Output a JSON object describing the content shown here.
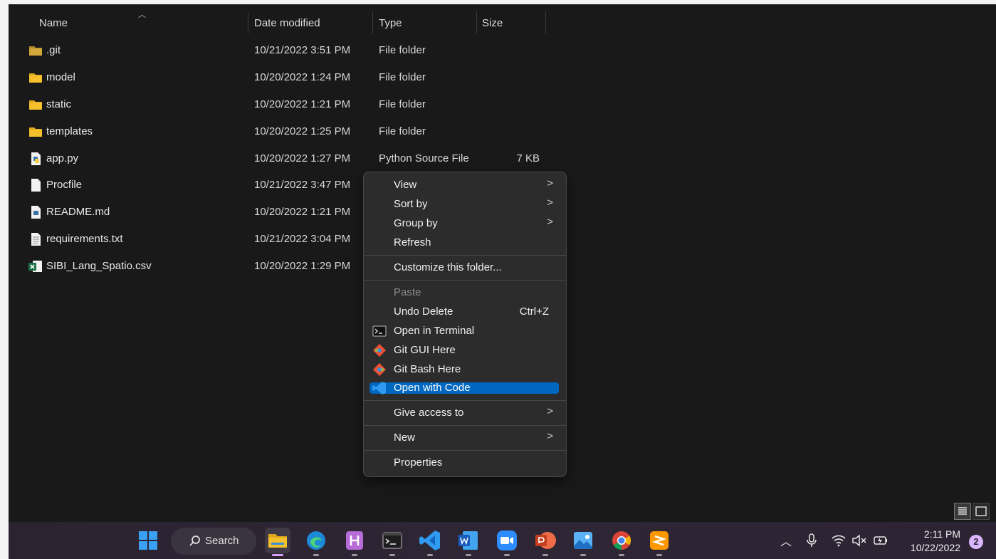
{
  "headers": {
    "name": "Name",
    "date": "Date modified",
    "type": "Type",
    "size": "Size"
  },
  "files": [
    {
      "name": ".git",
      "date": "10/21/2022 3:51 PM",
      "type": "File folder",
      "size": "",
      "icon": "folder-icon"
    },
    {
      "name": "model",
      "date": "10/20/2022 1:24 PM",
      "type": "File folder",
      "size": "",
      "icon": "folder-icon"
    },
    {
      "name": "static",
      "date": "10/20/2022 1:21 PM",
      "type": "File folder",
      "size": "",
      "icon": "folder-icon"
    },
    {
      "name": "templates",
      "date": "10/20/2022 1:25 PM",
      "type": "File folder",
      "size": "",
      "icon": "folder-icon"
    },
    {
      "name": "app.py",
      "date": "10/20/2022 1:27 PM",
      "type": "Python Source File",
      "size": "7 KB",
      "icon": "python-file-icon"
    },
    {
      "name": "Procfile",
      "date": "10/21/2022 3:47 PM",
      "type": "",
      "size": "",
      "icon": "blank-file-icon"
    },
    {
      "name": "README.md",
      "date": "10/20/2022 1:21 PM",
      "type": "",
      "size": "",
      "icon": "markdown-file-icon"
    },
    {
      "name": "requirements.txt",
      "date": "10/21/2022 3:04 PM",
      "type": "",
      "size": "",
      "icon": "text-file-icon"
    },
    {
      "name": "SIBI_Lang_Spatio.csv",
      "date": "10/20/2022 1:29 PM",
      "type": "",
      "size": "",
      "icon": "excel-file-icon"
    }
  ],
  "menu": {
    "view": "View",
    "sort_by": "Sort by",
    "group_by": "Group by",
    "refresh": "Refresh",
    "customize": "Customize this folder...",
    "paste": "Paste",
    "undo_delete": "Undo Delete",
    "undo_shortcut": "Ctrl+Z",
    "open_terminal": "Open in Terminal",
    "git_gui": "Git GUI Here",
    "git_bash": "Git Bash Here",
    "open_code": "Open with Code",
    "give_access": "Give access to",
    "new": "New",
    "properties": "Properties",
    "arrow": ">"
  },
  "taskbar": {
    "search": "Search",
    "time": "2:11 PM",
    "date": "10/22/2022",
    "notifications": "2",
    "apps": [
      "start-icon",
      "file-explorer-icon",
      "edge-icon",
      "hyper-icon",
      "terminal-icon",
      "vscode-icon",
      "word-icon",
      "zoom-icon",
      "powerpoint-icon",
      "photos-icon",
      "chrome-icon",
      "sublime-merge-icon"
    ]
  },
  "colors": {
    "highlight": "#0067c0",
    "folder": "#f5c02c",
    "background": "#191919",
    "menu": "#2c2c2c"
  }
}
